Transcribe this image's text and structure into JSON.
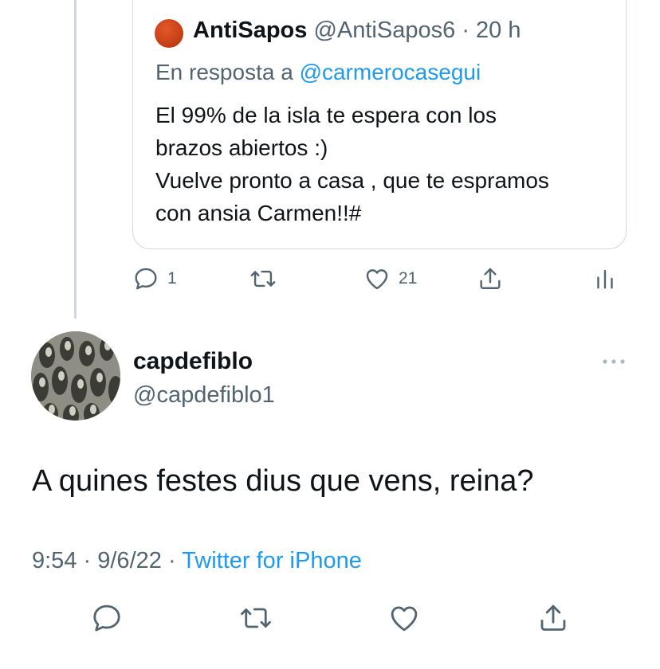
{
  "quoted_tweet": {
    "display_name": "AntiSapos",
    "handle": "@AntiSapos6",
    "separator": "·",
    "time": "20 h",
    "reply_prefix": "En resposta a",
    "reply_mention": "@carmerocasegui",
    "body_lines": [
      "El 99% de la isla te espera con los",
      "brazos abiertos :)",
      "Vuelve pronto a casa , que te espramos",
      "con ansia Carmen!!#"
    ],
    "actions": {
      "reply_count": "1",
      "like_count": "21"
    },
    "avatar_color": "#d84a1b"
  },
  "tweet": {
    "display_name": "capdefiblo",
    "handle": "@capdefiblo1",
    "text": "A quines festes dius que vens, reina?",
    "time": "9:54",
    "sep1": "·",
    "date": "9/6/22",
    "sep2": "·",
    "source": "Twitter for iPhone"
  },
  "icons": {
    "quoted_actions": [
      "reply-icon",
      "retweet-icon",
      "like-icon",
      "share-icon",
      "analytics-icon"
    ],
    "tweet_actions": [
      "reply-icon",
      "retweet-icon",
      "like-icon",
      "share-icon"
    ],
    "more": "more-icon"
  },
  "colors": {
    "text": "#0f1419",
    "secondary": "#536471",
    "link": "#1d9bf0",
    "border": "#cfd9de"
  }
}
